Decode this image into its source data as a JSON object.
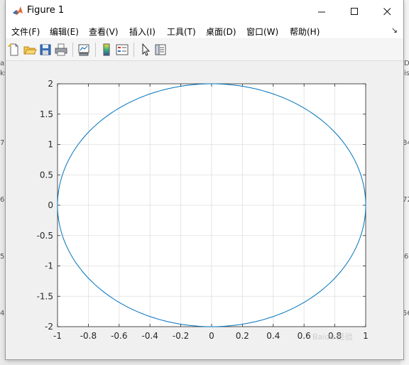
{
  "window": {
    "title": "Figure 1",
    "controls": [
      "—",
      "☐",
      "✕"
    ]
  },
  "menu": [
    {
      "label": "文件(F)"
    },
    {
      "label": "编辑(E)"
    },
    {
      "label": "查看(V)"
    },
    {
      "label": "插入(I)"
    },
    {
      "label": "工具(T)"
    },
    {
      "label": "桌面(D)"
    },
    {
      "label": "窗口(W)"
    },
    {
      "label": "帮助(H)"
    }
  ],
  "toolbar": {
    "buttons": [
      "new-figure-icon",
      "open-file-icon",
      "save-icon",
      "print-icon",
      "link-plot-icon",
      "colorbar-icon",
      "legend-icon",
      "edit-plot-arrow-icon",
      "property-inspector-icon"
    ]
  },
  "chart_data": {
    "type": "line",
    "title": "",
    "xlabel": "",
    "ylabel": "",
    "xlim": [
      -1,
      1
    ],
    "ylim": [
      -2,
      2
    ],
    "grid": true,
    "x_ticks": [
      "-1",
      "-0.8",
      "-0.6",
      "-0.4",
      "-0.2",
      "0",
      "0.2",
      "0.4",
      "0.6",
      "0.8",
      "1"
    ],
    "y_ticks": [
      "2",
      "1.5",
      "1",
      "0.5",
      "0",
      "-0.5",
      "-1",
      "-1.5",
      "-2"
    ],
    "series": [
      {
        "shape": "ellipse",
        "x_radius": 1,
        "y_radius": 2,
        "center": [
          0,
          0
        ],
        "color": "#0072bd"
      }
    ]
  },
  "background_fragments": {
    "left": [
      "a",
      "ks",
      "7",
      "6",
      "5",
      "4"
    ],
    "right": [
      "Da",
      "is",
      "84",
      "72",
      "6",
      "56"
    ]
  },
  "watermark": "Baidu 经验"
}
